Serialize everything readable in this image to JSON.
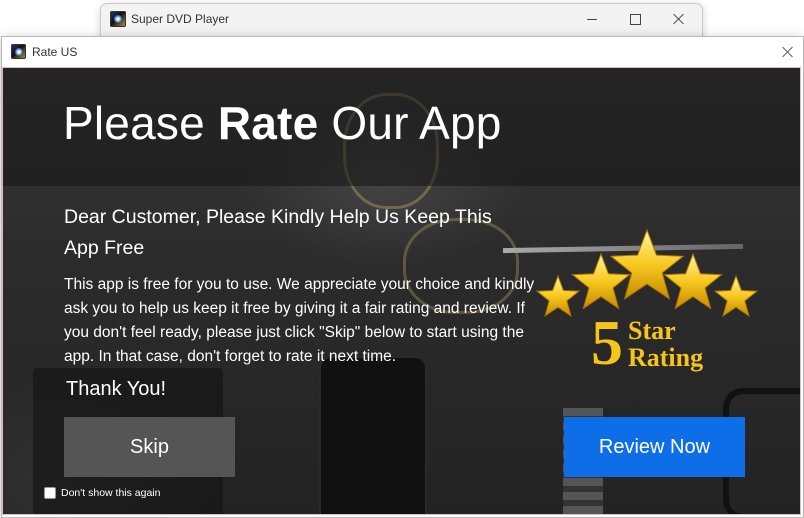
{
  "parent_window": {
    "title": "Super DVD Player"
  },
  "dialog": {
    "title": "Rate US",
    "headline_pre": "Please ",
    "headline_bold": "Rate",
    "headline_post": " Our App",
    "subheading": "Dear Customer, Please Kindly Help Us Keep This App Free",
    "body": "This app is free for you to use. We appreciate your choice and kindly ask you to help us keep it free by giving it a fair rating and review. If you don't feel ready, please just click \"Skip\" below to start using the app. In that case, don't forget to rate it next time.",
    "thanks": "Thank You!",
    "skip_label": "Skip",
    "review_label": "Review Now",
    "dont_show_label": "Don't show this again",
    "dont_show_checked": false,
    "badge": {
      "number": "5",
      "line1": "Star",
      "line2": "Rating"
    }
  },
  "colors": {
    "review_button": "#0d6ee8",
    "skip_button": "#555555",
    "star_gold": "#f2b705",
    "badge_text": "#f5c518"
  },
  "icons": [
    "app-icon",
    "minimize-icon",
    "maximize-icon",
    "close-icon",
    "star-icon",
    "checkbox-icon"
  ]
}
